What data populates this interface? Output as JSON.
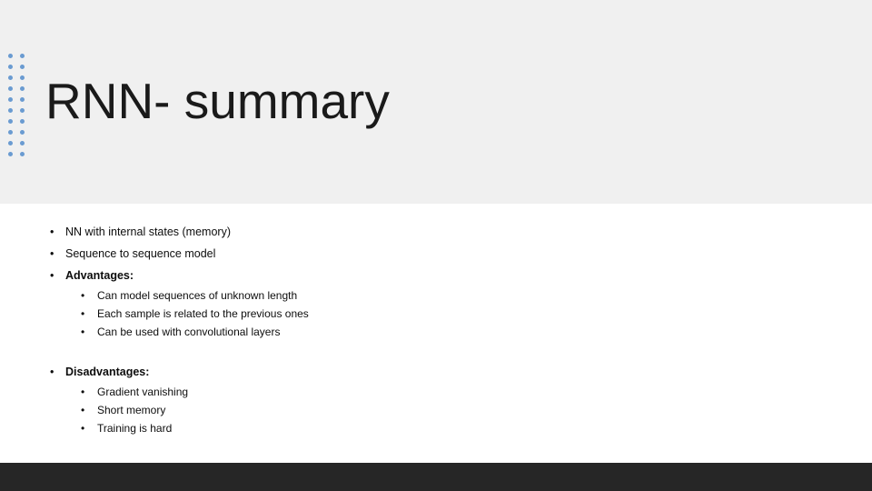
{
  "slide": {
    "title": "RNN- summary",
    "decoration": {
      "name": "dot-grid",
      "color": "#6a9bd1",
      "columns": 2,
      "rows": 10
    },
    "header_band_color": "#f0f0f0",
    "footer_bar_color": "#262626",
    "background_color": "#ffffff",
    "bullet_glyph": "•",
    "body": [
      {
        "level": 1,
        "bold": false,
        "text": "NN with internal states (memory)"
      },
      {
        "level": 1,
        "bold": false,
        "text": "Sequence to sequence model"
      },
      {
        "level": 1,
        "bold": true,
        "text": "Advantages:"
      },
      {
        "level": 2,
        "bold": false,
        "text": "Can model sequences of unknown length"
      },
      {
        "level": 2,
        "bold": false,
        "text": "Each sample is related to the previous ones"
      },
      {
        "level": 2,
        "bold": false,
        "text": "Can be used with convolutional layers"
      },
      {
        "level": 1,
        "bold": true,
        "text": "Disadvantages:",
        "gap_before": true
      },
      {
        "level": 2,
        "bold": false,
        "text": "Gradient vanishing"
      },
      {
        "level": 2,
        "bold": false,
        "text": "Short memory"
      },
      {
        "level": 2,
        "bold": false,
        "text": "Training is hard"
      }
    ]
  }
}
